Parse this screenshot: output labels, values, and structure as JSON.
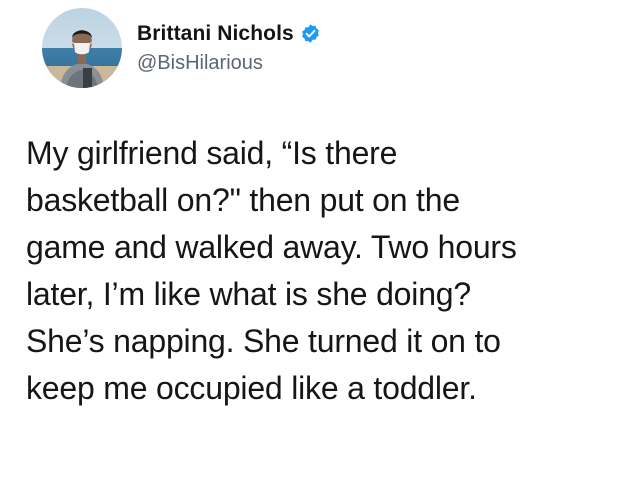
{
  "tweet": {
    "author": {
      "display_name": "Brittani Nichols",
      "handle": "@BisHilarious",
      "verified": true,
      "verified_icon": "verified-badge-icon",
      "verified_color": "#1d9bf0"
    },
    "text_lines": [
      "My girlfriend said, “Is there",
      "basketball on?\" then put on the",
      "game and walked away. Two hours",
      "later, I’m like what is she doing?",
      "She’s napping. She turned it on to",
      "keep me occupied like a toddler."
    ]
  }
}
